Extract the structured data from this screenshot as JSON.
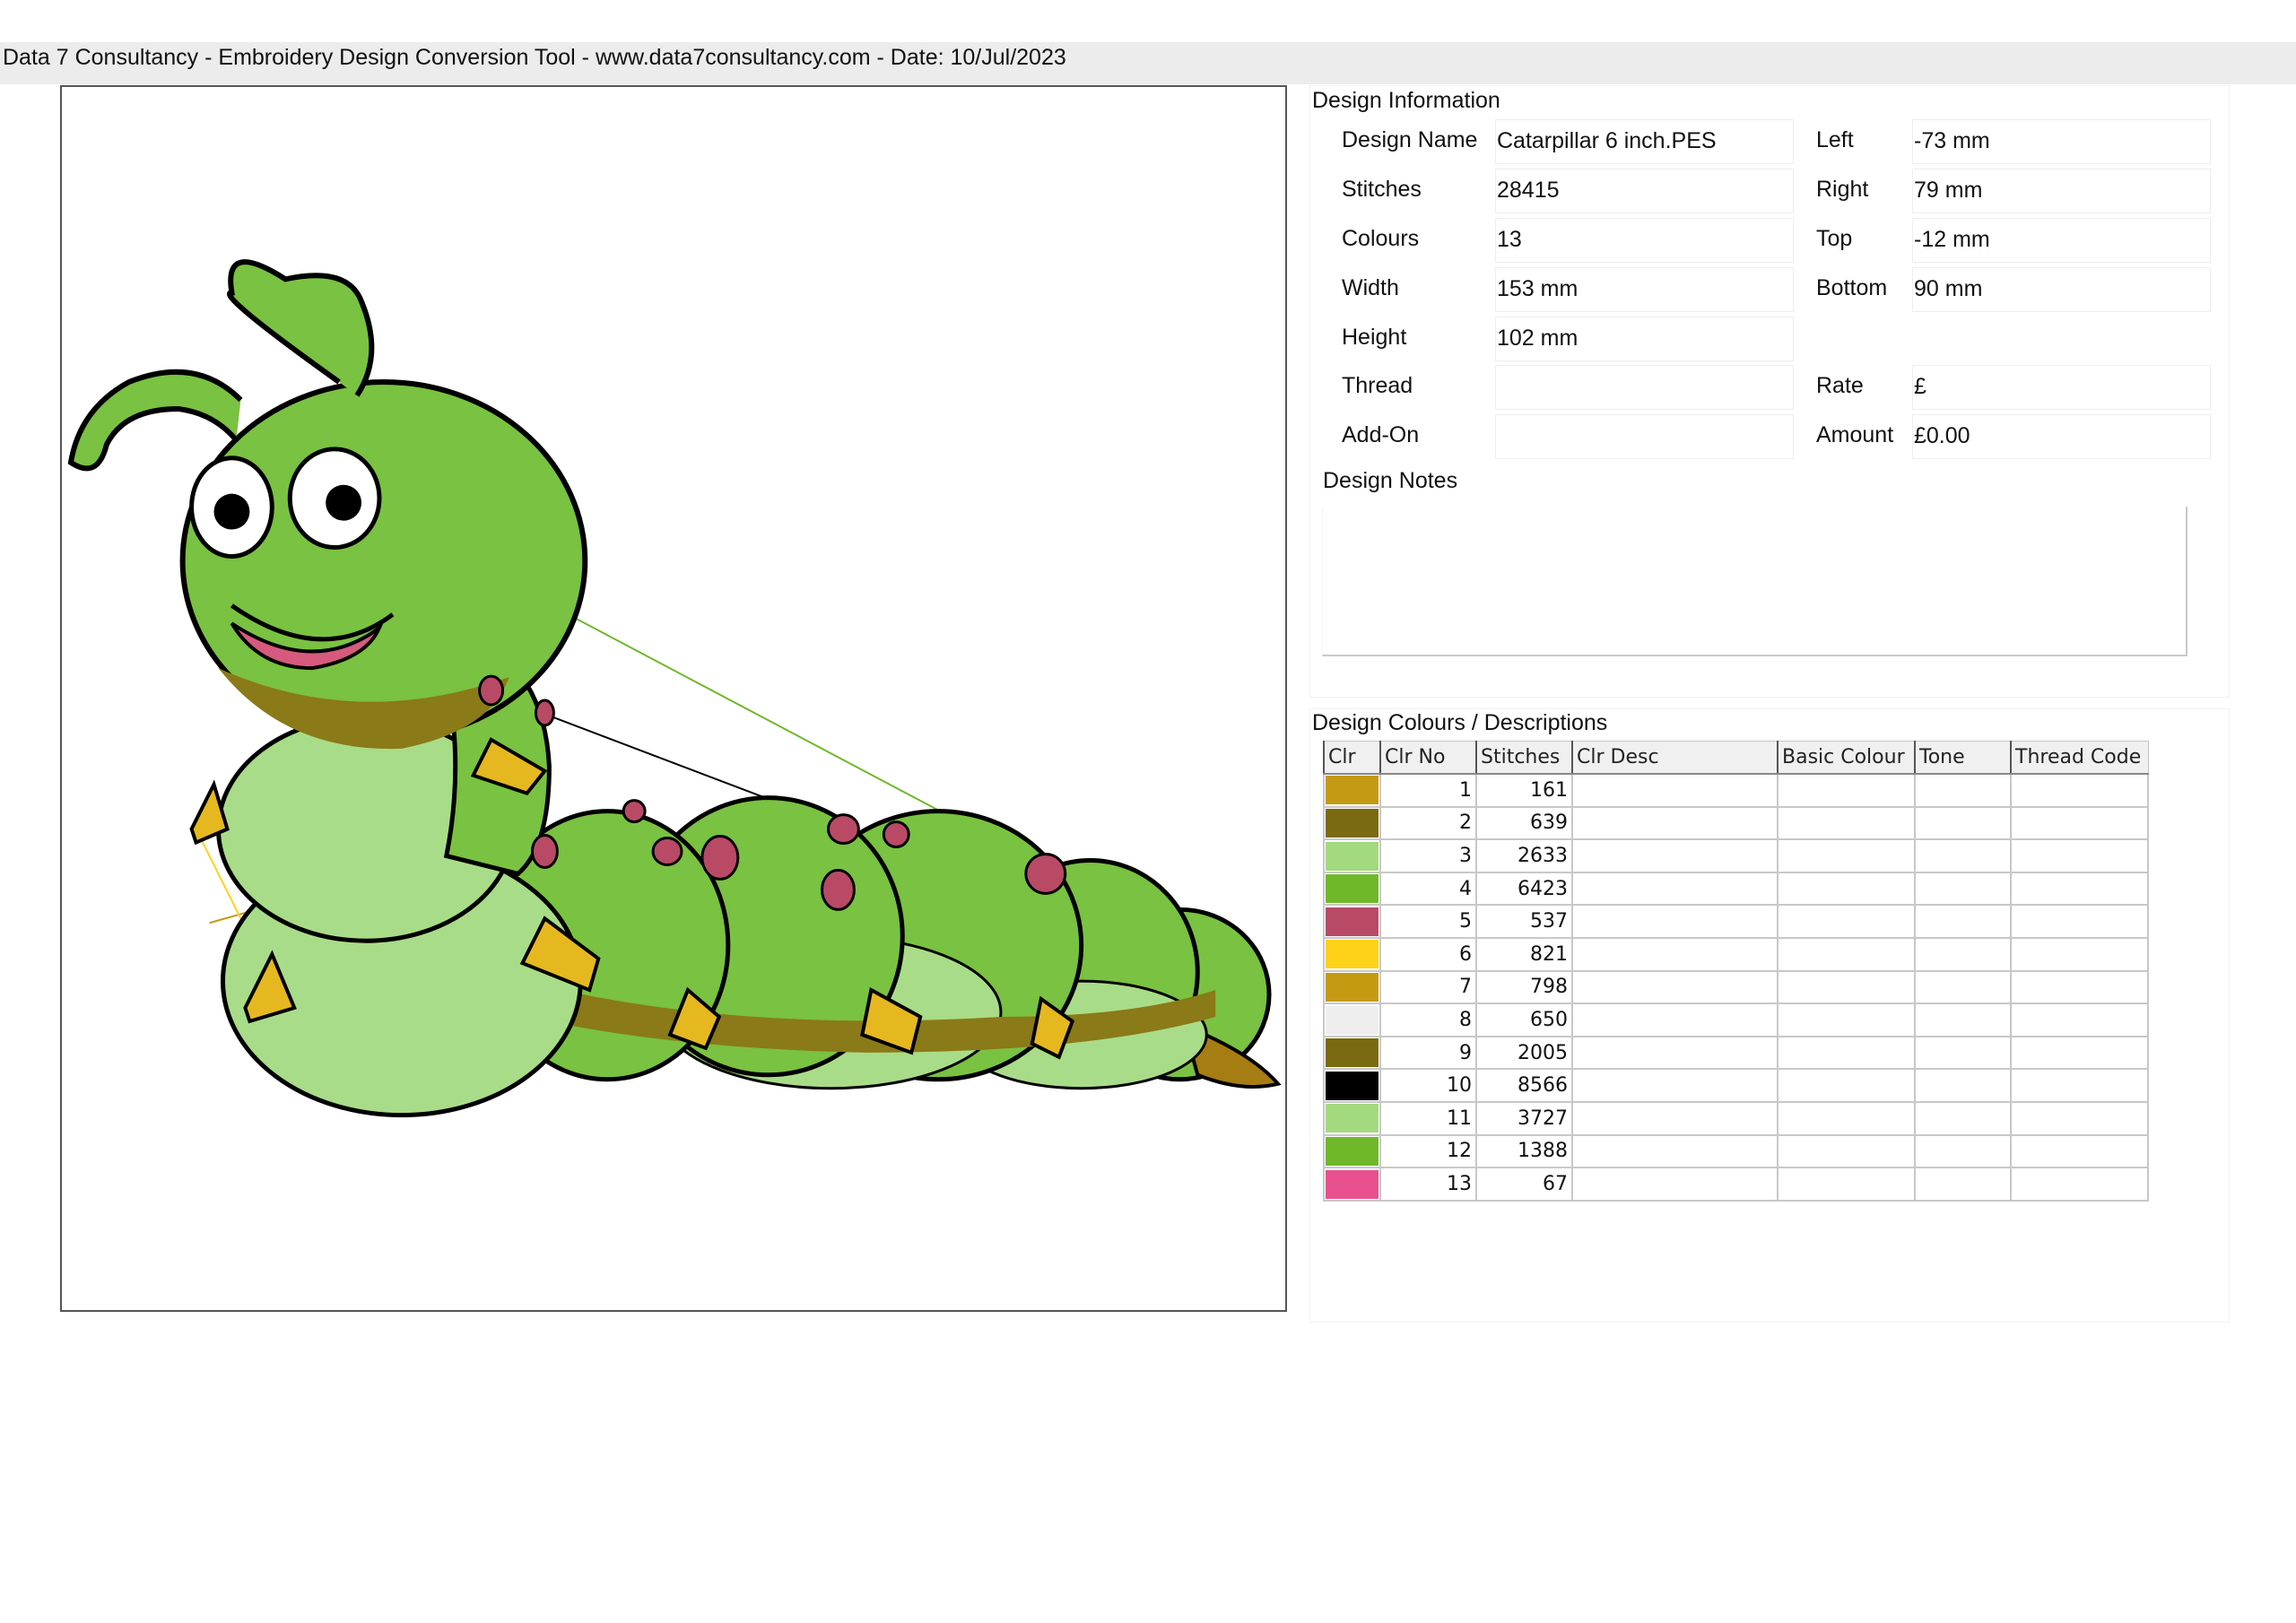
{
  "header": {
    "title": "Data 7 Consultancy - Embroidery Design Conversion Tool - www.data7consultancy.com - Date: 10/Jul/2023"
  },
  "design_info": {
    "section_title": "Design Information",
    "left_fields": [
      {
        "label": "Design Name",
        "value": "Catarpillar 6 inch.PES"
      },
      {
        "label": "Stitches",
        "value": "28415"
      },
      {
        "label": "Colours",
        "value": "13"
      },
      {
        "label": "Width",
        "value": "153 mm"
      },
      {
        "label": "Height",
        "value": "102 mm"
      },
      {
        "label": "Thread",
        "value": ""
      },
      {
        "label": "Add-On",
        "value": ""
      }
    ],
    "right_fields": [
      {
        "label": "Left",
        "value": "-73 mm"
      },
      {
        "label": "Right",
        "value": "79 mm"
      },
      {
        "label": "Top",
        "value": "-12 mm"
      },
      {
        "label": "Bottom",
        "value": "90 mm"
      },
      {
        "label": "Rate",
        "value": "£"
      },
      {
        "label": "Amount",
        "value": "£0.00"
      }
    ],
    "notes_label": "Design Notes",
    "notes_value": ""
  },
  "colours": {
    "section_title": "Design Colours / Descriptions",
    "columns": [
      "Clr",
      "Clr No",
      "Stitches",
      "Clr Desc",
      "Basic Colour",
      "Tone",
      "Thread Code"
    ],
    "rows": [
      {
        "color": "#c49a12",
        "no": "1",
        "stitches": "161",
        "desc": "",
        "basic": "",
        "tone": "",
        "code": ""
      },
      {
        "color": "#7a6a12",
        "no": "2",
        "stitches": "639",
        "desc": "",
        "basic": "",
        "tone": "",
        "code": ""
      },
      {
        "color": "#a3d97f",
        "no": "3",
        "stitches": "2633",
        "desc": "",
        "basic": "",
        "tone": "",
        "code": ""
      },
      {
        "color": "#6fb82a",
        "no": "4",
        "stitches": "6423",
        "desc": "",
        "basic": "",
        "tone": "",
        "code": ""
      },
      {
        "color": "#b84a66",
        "no": "5",
        "stitches": "537",
        "desc": "",
        "basic": "",
        "tone": "",
        "code": ""
      },
      {
        "color": "#ffd21a",
        "no": "6",
        "stitches": "821",
        "desc": "",
        "basic": "",
        "tone": "",
        "code": ""
      },
      {
        "color": "#c49a12",
        "no": "7",
        "stitches": "798",
        "desc": "",
        "basic": "",
        "tone": "",
        "code": ""
      },
      {
        "color": "#eeeeee",
        "no": "8",
        "stitches": "650",
        "desc": "",
        "basic": "",
        "tone": "",
        "code": ""
      },
      {
        "color": "#7a6a12",
        "no": "9",
        "stitches": "2005",
        "desc": "",
        "basic": "",
        "tone": "",
        "code": ""
      },
      {
        "color": "#000000",
        "no": "10",
        "stitches": "8566",
        "desc": "",
        "basic": "",
        "tone": "",
        "code": ""
      },
      {
        "color": "#a3d97f",
        "no": "11",
        "stitches": "3727",
        "desc": "",
        "basic": "",
        "tone": "",
        "code": ""
      },
      {
        "color": "#6fb82a",
        "no": "12",
        "stitches": "1388",
        "desc": "",
        "basic": "",
        "tone": "",
        "code": ""
      },
      {
        "color": "#e8508e",
        "no": "13",
        "stitches": "67",
        "desc": "",
        "basic": "",
        "tone": "",
        "code": ""
      }
    ]
  }
}
